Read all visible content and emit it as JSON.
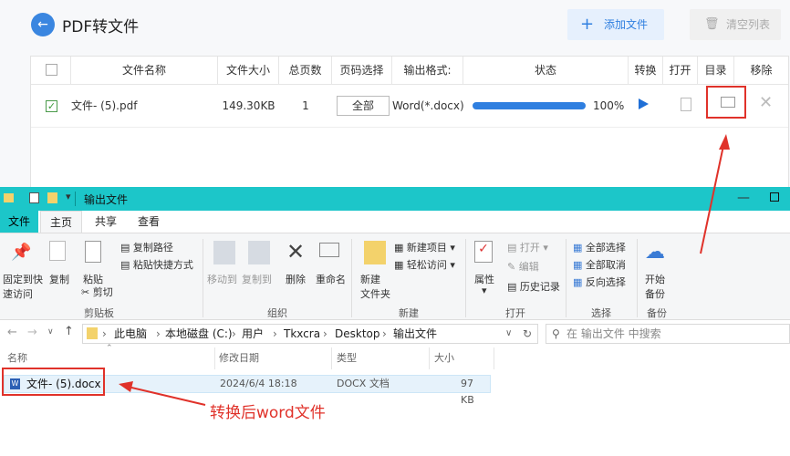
{
  "app": {
    "title": "PDF转文件",
    "add_file": "添加文件",
    "clear_list": "清空列表",
    "columns": [
      "文件名称",
      "文件大小",
      "总页数",
      "页码选择",
      "输出格式:",
      "状态",
      "转换",
      "打开",
      "目录",
      "移除"
    ],
    "row": {
      "name": "文件- (5).pdf",
      "size": "149.30KB",
      "pages": "1",
      "page_select": "全部",
      "format": "Word(*.docx)",
      "progress_pct": 100,
      "progress_label": "100%"
    },
    "accent": "#2f7fe0"
  },
  "explorer": {
    "title": "输出文件",
    "tabs": [
      "文件",
      "主页",
      "共享",
      "查看"
    ],
    "clipboard": {
      "pin": "固定到快速访问",
      "copy": "复制",
      "paste": "粘贴",
      "copy_path": "复制路径",
      "paste_shortcut": "粘贴快捷方式",
      "cut": "剪切",
      "group": "剪贴板"
    },
    "organize": {
      "move_to": "移动到",
      "copy_to": "复制到",
      "delete": "删除",
      "rename": "重命名",
      "group": "组织"
    },
    "new": {
      "new_folder": "新建文件夹",
      "new_item": "新建项目",
      "easy_access": "轻松访问",
      "group": "新建"
    },
    "open": {
      "properties": "属性",
      "open": "打开",
      "edit": "编辑",
      "history": "历史记录",
      "group": "打开"
    },
    "select": {
      "select_all": "全部选择",
      "select_none": "全部取消",
      "invert": "反向选择",
      "group": "选择"
    },
    "backup": {
      "start_backup": "开始备份",
      "group": "备份"
    },
    "breadcrumb": [
      "此电脑",
      "本地磁盘 (C:)",
      "用户",
      "Tkxcra",
      "Desktop",
      "输出文件"
    ],
    "search_placeholder": "在 输出文件 中搜索",
    "columns": [
      "名称",
      "修改日期",
      "类型",
      "大小"
    ],
    "file": {
      "name": "文件- (5).docx",
      "date": "2024/6/4 18:18",
      "type": "DOCX 文档",
      "size": "97 KB"
    }
  },
  "annotation": "转换后word文件",
  "colors": {
    "annotation": "#e0322a",
    "titlebar": "#1cc6c9"
  }
}
